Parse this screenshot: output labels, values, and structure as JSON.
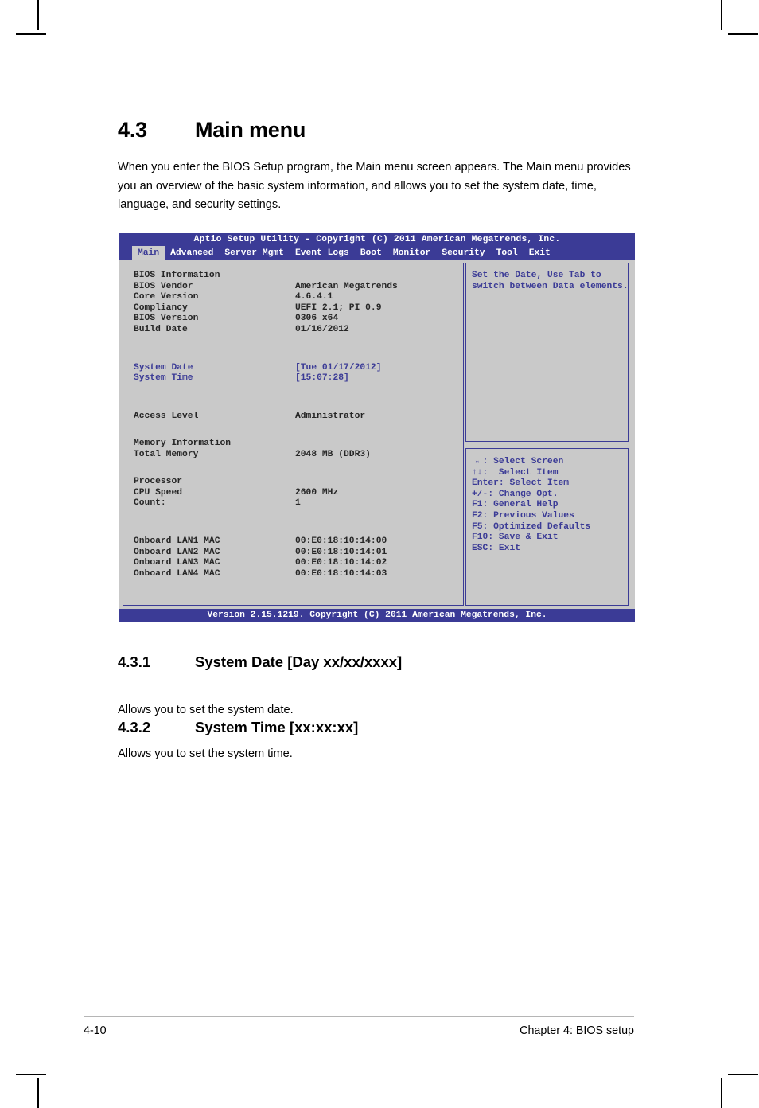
{
  "document": {
    "section": {
      "number": "4.3",
      "title": "Main menu",
      "intro": "When you enter the BIOS Setup program, the Main menu screen appears. The Main menu provides you an overview of the basic system information, and allows you to set the system date, time, language, and security settings."
    },
    "subsections": [
      {
        "number": "4.3.1",
        "title": "System Date [Day xx/xx/xxxx]",
        "body": "Allows you to set the system date."
      },
      {
        "number": "4.3.2",
        "title": "System Time [xx:xx:xx]",
        "body": "Allows you to set the system time."
      }
    ],
    "footer": {
      "page_number": "4-10",
      "chapter": "Chapter 4: BIOS setup"
    }
  },
  "bios": {
    "titlebar": "Aptio Setup Utility - Copyright (C) 2011 American Megatrends, Inc.",
    "tabs": [
      {
        "label": "Main",
        "active": true
      },
      {
        "label": "Advanced",
        "active": false
      },
      {
        "label": "Server Mgmt",
        "active": false
      },
      {
        "label": "Event Logs",
        "active": false
      },
      {
        "label": "Boot",
        "active": false
      },
      {
        "label": "Monitor",
        "active": false
      },
      {
        "label": "Security",
        "active": false
      },
      {
        "label": "Tool",
        "active": false
      },
      {
        "label": "Exit",
        "active": false
      }
    ],
    "items": [
      {
        "label": "BIOS Information",
        "value": "",
        "highlight": false
      },
      {
        "label": "BIOS Vendor",
        "value": "American Megatrends",
        "highlight": false
      },
      {
        "label": "Core Version",
        "value": "4.6.4.1",
        "highlight": false
      },
      {
        "label": "Compliancy",
        "value": "UEFI 2.1; PI 0.9",
        "highlight": false
      },
      {
        "label": "BIOS Version",
        "value": "0306 x64",
        "highlight": false
      },
      {
        "label": "Build Date",
        "value": "01/16/2012",
        "highlight": false
      },
      {
        "label": "System Date",
        "value": "[Tue 01/17/2012]",
        "highlight": true
      },
      {
        "label": "System Time",
        "value": "[15:07:28]",
        "highlight": true
      },
      {
        "label": "Access Level",
        "value": "Administrator",
        "highlight": false
      },
      {
        "label": "Memory Information",
        "value": "",
        "highlight": false
      },
      {
        "label": "Total Memory",
        "value": "2048 MB (DDR3)",
        "highlight": false
      },
      {
        "label": "Processor",
        "value": "",
        "highlight": false
      },
      {
        "label": "CPU Speed",
        "value": "2600 MHz",
        "highlight": false
      },
      {
        "label": "Count:",
        "value": "1",
        "highlight": false
      },
      {
        "label": "Onboard LAN1 MAC",
        "value": "00:E0:18:10:14:00",
        "highlight": false
      },
      {
        "label": "Onboard LAN2 MAC",
        "value": "00:E0:18:10:14:01",
        "highlight": false
      },
      {
        "label": "Onboard LAN3 MAC",
        "value": "00:E0:18:10:14:02",
        "highlight": false
      },
      {
        "label": "Onboard LAN4 MAC",
        "value": "00:E0:18:10:14:03",
        "highlight": false
      }
    ],
    "help": {
      "line1": "Set the Date, Use Tab to",
      "line2": "switch between Data elements."
    },
    "navkeys": [
      "→←: Select Screen",
      "↑↓:  Select Item",
      "Enter: Select Item",
      "+/-: Change Opt.",
      "F1: General Help",
      "F2: Previous Values",
      "F5: Optimized Defaults",
      "F10: Save & Exit",
      "ESC: Exit"
    ],
    "footer": "Version 2.15.1219. Copyright (C) 2011 American Megatrends, Inc.",
    "colors": {
      "chrome_blue": "#3b3b96",
      "panel_gray": "#c9c9c9",
      "tab_active_bg": "#cccccc"
    }
  }
}
